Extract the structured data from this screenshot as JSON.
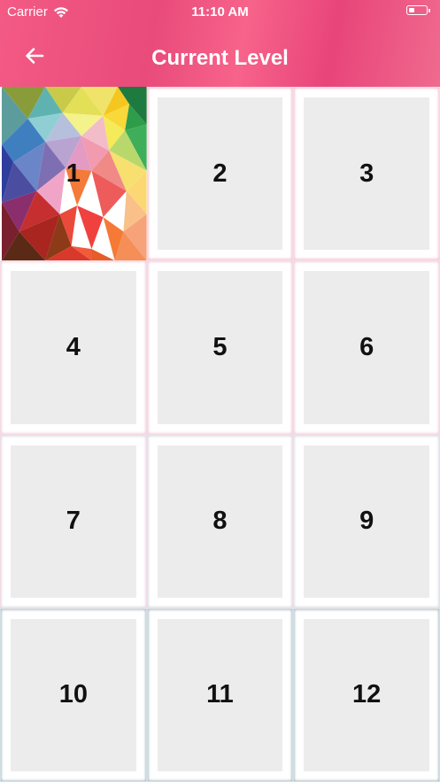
{
  "status_bar": {
    "carrier": "Carrier",
    "time": "11:10 AM",
    "battery_level": 0.35
  },
  "header": {
    "title": "Current Level",
    "back_icon": "arrow-left-icon"
  },
  "levels": [
    {
      "label": "1",
      "unlocked": true
    },
    {
      "label": "2",
      "unlocked": false
    },
    {
      "label": "3",
      "unlocked": false
    },
    {
      "label": "4",
      "unlocked": false
    },
    {
      "label": "5",
      "unlocked": false
    },
    {
      "label": "6",
      "unlocked": false
    },
    {
      "label": "7",
      "unlocked": false
    },
    {
      "label": "8",
      "unlocked": false
    },
    {
      "label": "9",
      "unlocked": false
    },
    {
      "label": "10",
      "unlocked": false
    },
    {
      "label": "11",
      "unlocked": false
    },
    {
      "label": "12",
      "unlocked": false
    }
  ],
  "colors": {
    "header_accent": "#e94b7b",
    "tile_placeholder": "#ececec"
  }
}
